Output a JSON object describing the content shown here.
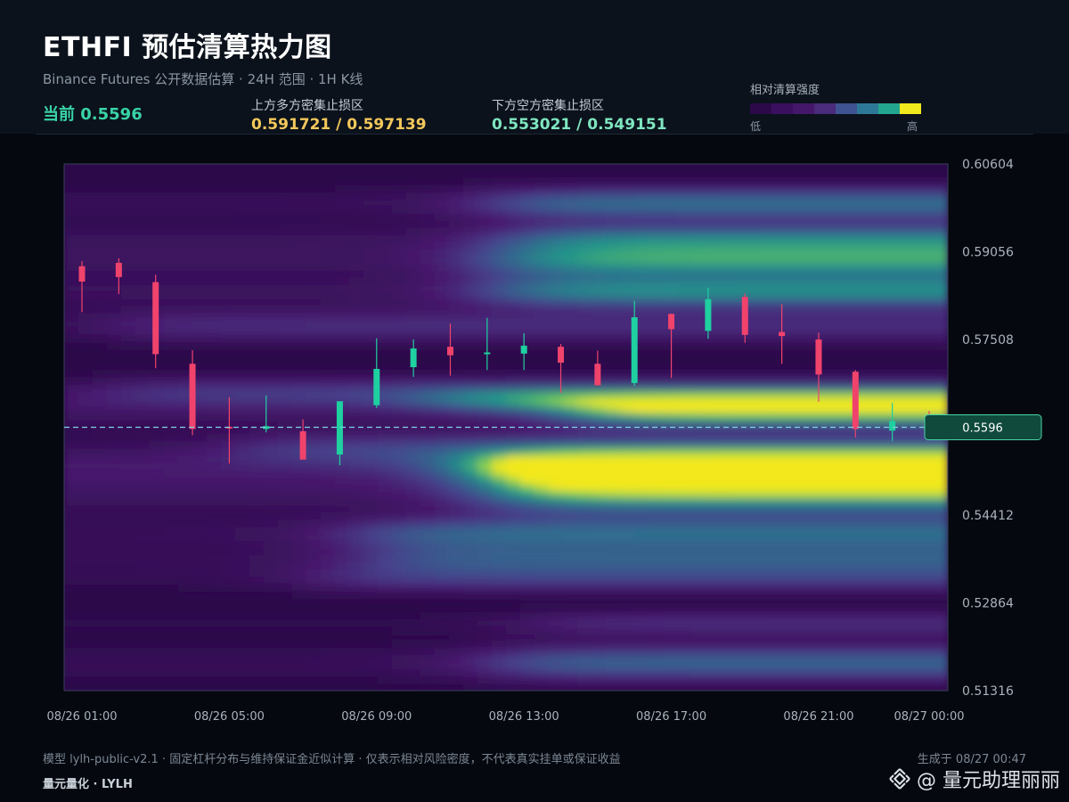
{
  "header": {
    "title": "ETHFI 预估清算热力图",
    "subtitle": "Binance Futures 公开数据估算 · 24H 范围 · 1H K线",
    "current_label": "当前 0.5596",
    "upper_zone_label": "上方多方密集止损区",
    "upper_zone_value": "0.591721 / 0.597139",
    "lower_zone_label": "下方空方密集止损区",
    "lower_zone_value": "0.553021 / 0.549151"
  },
  "legend": {
    "title": "相对清算强度",
    "low": "低",
    "high": "高",
    "colors": [
      "#2c0a4a",
      "#3a0f5e",
      "#44176a",
      "#4a2a7a",
      "#3f5291",
      "#2d7896",
      "#23a68f",
      "#f2e81e"
    ]
  },
  "colors": {
    "up_candle": "#1fd0a0",
    "down_candle": "#f0436c",
    "current_line": "#7fd1e6",
    "price_tag_bg": "#0f4a3c",
    "price_tag_border": "#4bd3a3"
  },
  "chart_data": {
    "type": "heatmap",
    "overlay": "candlestick",
    "y_axis": {
      "ylim": [
        0.51316,
        0.60604
      ],
      "tick_labels": [
        "0.60604",
        "0.59056",
        "0.57508",
        "0.55960",
        "0.54412",
        "0.52864",
        "0.51316"
      ],
      "visible_tick_labels": [
        "0.60604",
        "0.59056",
        "0.57508",
        "0.54412",
        "0.52864",
        "0.51316"
      ]
    },
    "x_axis": {
      "tick_labels": [
        "08/26 01:00",
        "08/26 05:00",
        "08/26 09:00",
        "08/26 13:00",
        "08/26 17:00",
        "08/26 21:00",
        "08/27 00:00"
      ],
      "candle_times": [
        "08/26 01:00",
        "08/26 02:00",
        "08/26 03:00",
        "08/26 04:00",
        "08/26 05:00",
        "08/26 06:00",
        "08/26 07:00",
        "08/26 08:00",
        "08/26 09:00",
        "08/26 10:00",
        "08/26 11:00",
        "08/26 12:00",
        "08/26 13:00",
        "08/26 14:00",
        "08/26 15:00",
        "08/26 16:00",
        "08/26 17:00",
        "08/26 18:00",
        "08/26 19:00",
        "08/26 20:00",
        "08/26 21:00",
        "08/26 22:00",
        "08/26 23:00",
        "08/27 00:00"
      ]
    },
    "current_price": 0.5596,
    "current_price_label": "0.5596",
    "candles": [
      {
        "o": 0.588,
        "h": 0.5889,
        "l": 0.5799,
        "c": 0.5853
      },
      {
        "o": 0.5886,
        "h": 0.5894,
        "l": 0.5831,
        "c": 0.5861
      },
      {
        "o": 0.5852,
        "h": 0.5865,
        "l": 0.57,
        "c": 0.5725
      },
      {
        "o": 0.5708,
        "h": 0.5732,
        "l": 0.5582,
        "c": 0.5593
      },
      {
        "o": 0.5597,
        "h": 0.5649,
        "l": 0.5532,
        "c": 0.5594
      },
      {
        "o": 0.5593,
        "h": 0.5652,
        "l": 0.5587,
        "c": 0.5598
      },
      {
        "o": 0.5589,
        "h": 0.561,
        "l": 0.554,
        "c": 0.5539
      },
      {
        "o": 0.5548,
        "h": 0.5639,
        "l": 0.5529,
        "c": 0.5642
      },
      {
        "o": 0.5635,
        "h": 0.5753,
        "l": 0.563,
        "c": 0.5699
      },
      {
        "o": 0.5702,
        "h": 0.5751,
        "l": 0.5685,
        "c": 0.5735
      },
      {
        "o": 0.5738,
        "h": 0.5779,
        "l": 0.5687,
        "c": 0.5723
      },
      {
        "o": 0.5726,
        "h": 0.5789,
        "l": 0.5697,
        "c": 0.5728
      },
      {
        "o": 0.5726,
        "h": 0.5762,
        "l": 0.5697,
        "c": 0.574
      },
      {
        "o": 0.5738,
        "h": 0.5743,
        "l": 0.5657,
        "c": 0.571
      },
      {
        "o": 0.5708,
        "h": 0.5731,
        "l": 0.5673,
        "c": 0.567
      },
      {
        "o": 0.5674,
        "h": 0.5819,
        "l": 0.5669,
        "c": 0.579
      },
      {
        "o": 0.5796,
        "h": 0.5796,
        "l": 0.5683,
        "c": 0.5769
      },
      {
        "o": 0.5766,
        "h": 0.5842,
        "l": 0.5752,
        "c": 0.5822
      },
      {
        "o": 0.5826,
        "h": 0.5832,
        "l": 0.5745,
        "c": 0.5759
      },
      {
        "o": 0.5764,
        "h": 0.5813,
        "l": 0.5708,
        "c": 0.5757
      },
      {
        "o": 0.5751,
        "h": 0.5763,
        "l": 0.5641,
        "c": 0.5689
      },
      {
        "o": 0.5694,
        "h": 0.5697,
        "l": 0.5578,
        "c": 0.5593
      },
      {
        "o": 0.559,
        "h": 0.5639,
        "l": 0.5572,
        "c": 0.5607
      },
      {
        "o": 0.5612,
        "h": 0.5625,
        "l": 0.5584,
        "c": 0.5596
      }
    ],
    "bands": [
      {
        "center": 0.549,
        "width": 0.0032,
        "t_start": 11.0,
        "intensity": 1.0
      },
      {
        "center": 0.553,
        "width": 0.002,
        "t_start": 10.5,
        "intensity": 0.8
      },
      {
        "center": 0.562,
        "width": 0.0018,
        "t_start": 13.0,
        "intensity": 0.8
      },
      {
        "center": 0.5645,
        "width": 0.0015,
        "t_start": 9.5,
        "intensity": 0.55
      },
      {
        "center": 0.5408,
        "width": 0.002,
        "t_start": 7.5,
        "intensity": 0.55
      },
      {
        "center": 0.5365,
        "width": 0.0018,
        "t_start": 8.0,
        "intensity": 0.45
      },
      {
        "center": 0.533,
        "width": 0.0018,
        "t_start": 6.5,
        "intensity": 0.35
      },
      {
        "center": 0.518,
        "width": 0.0022,
        "t_start": 11.0,
        "intensity": 0.55
      },
      {
        "center": 0.525,
        "width": 0.0015,
        "t_start": 12.0,
        "intensity": 0.3
      },
      {
        "center": 0.5835,
        "width": 0.002,
        "t_start": 11.0,
        "intensity": 0.7
      },
      {
        "center": 0.589,
        "width": 0.0022,
        "t_start": 11.0,
        "intensity": 0.75
      },
      {
        "center": 0.593,
        "width": 0.0018,
        "t_start": 11.5,
        "intensity": 0.55
      },
      {
        "center": 0.599,
        "width": 0.002,
        "t_start": 11.0,
        "intensity": 0.6
      },
      {
        "center": 0.5775,
        "width": 0.002,
        "t_start": 1.0,
        "intensity": 0.3
      },
      {
        "center": 0.566,
        "width": 0.0018,
        "t_start": 1.0,
        "intensity": 0.3
      },
      {
        "center": 0.556,
        "width": 0.002,
        "t_start": 4.5,
        "intensity": 0.35
      }
    ]
  },
  "footer": {
    "note": "模型 lylh-public-v2.1 · 固定杠杆分布与维持保证金近似计算 · 仅表示相对风险密度，不代表真实挂单或保证收益",
    "brand": "量元量化 · LYLH",
    "generated": "生成于 08/27 00:47",
    "watermark": "@ 量元助理丽丽"
  }
}
